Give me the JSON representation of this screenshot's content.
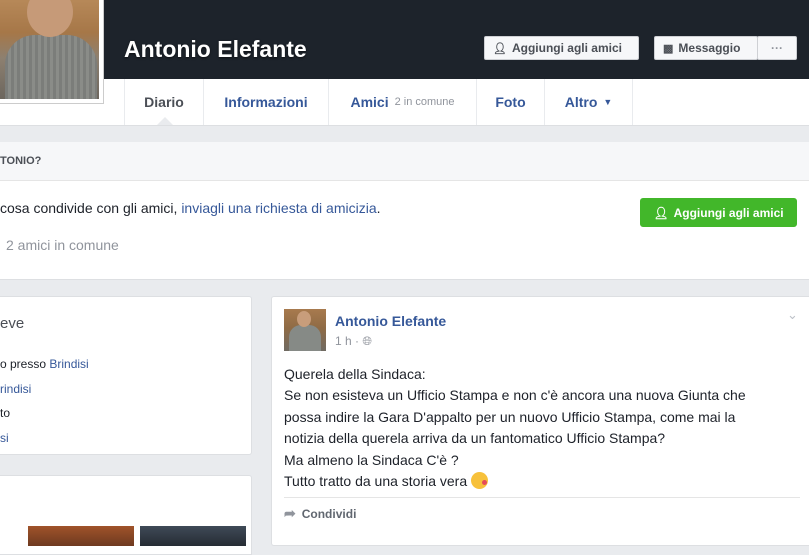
{
  "profile": {
    "name": "Antonio Elefante"
  },
  "cover_buttons": {
    "add_friend": "Aggiungi agli amici",
    "message": "Messaggio",
    "more": "···"
  },
  "tabs": [
    {
      "label": "Diario"
    },
    {
      "label": "Informazioni"
    },
    {
      "label": "Amici",
      "sub": "2 in comune"
    },
    {
      "label": "Foto"
    },
    {
      "label": "Altro"
    }
  ],
  "friend_request": {
    "header": "TONIO?",
    "text_plain": " cosa condivide con gli amici, ",
    "text_link": "inviagli una richiesta di amicizia",
    "text_end": ".",
    "mutual": "2 amici in comune",
    "button": "Aggiungi agli amici"
  },
  "intro": {
    "title": "eve",
    "lines": [
      {
        "plain": "o presso ",
        "link": "Brindisi"
      },
      {
        "plain": "",
        "link": "rindisi"
      },
      {
        "plain": "to",
        "link": ""
      },
      {
        "plain": "",
        "link": "si"
      }
    ]
  },
  "post": {
    "author": "Antonio Elefante",
    "time": "1 h · ",
    "lines": [
      "Querela della Sindaca:",
      "Se non esisteva un Ufficio Stampa e non c'è ancora una nuova Giunta che",
      "possa indire la Gara D'appalto per un nuovo Ufficio Stampa, come mai la",
      "notizia della querela arriva da un fantomatico Ufficio Stampa?",
      "Ma almeno la Sindaca C'è ?",
      "Tutto tratto da una storia vera "
    ],
    "share": "Condividi"
  },
  "colors": {
    "cover": "#1d232b",
    "link": "#365899",
    "green": "#42b72a",
    "background": "#e9ebee"
  }
}
